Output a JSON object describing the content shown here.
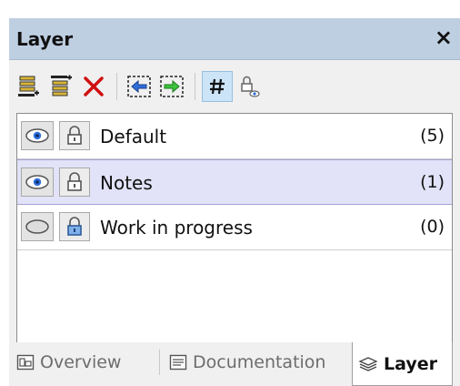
{
  "panel": {
    "title": "Layer",
    "close_glyph": "×"
  },
  "toolbar": {
    "buttons": [
      {
        "icon": "add-layer-below-icon"
      },
      {
        "icon": "add-layer-above-icon"
      },
      {
        "icon": "delete-layer-icon"
      },
      {
        "icon": "move-to-layer-left-icon"
      },
      {
        "icon": "move-to-layer-right-icon"
      },
      {
        "icon": "layer-count-toggle-icon",
        "active": true
      },
      {
        "icon": "lock-visibility-icon"
      }
    ]
  },
  "layers": [
    {
      "name": "Default",
      "count": "(5)",
      "visible": true,
      "locked": false,
      "selected": false
    },
    {
      "name": "Notes",
      "count": "(1)",
      "visible": true,
      "locked": false,
      "selected": true
    },
    {
      "name": "Work in progress",
      "count": "(0)",
      "visible": false,
      "locked": true,
      "selected": false
    }
  ],
  "tabs": [
    {
      "label": "Overview",
      "icon": "overview-icon",
      "active": false
    },
    {
      "label": "Documentation",
      "icon": "documentation-icon",
      "active": false
    },
    {
      "label": "Layer",
      "icon": "layer-stack-icon",
      "active": true
    }
  ],
  "colors": {
    "titlebar": "#bfcfe2",
    "selected_row": "#e2e2f8",
    "active_tool": "#cce4f7",
    "delete_red": "#d01010"
  }
}
